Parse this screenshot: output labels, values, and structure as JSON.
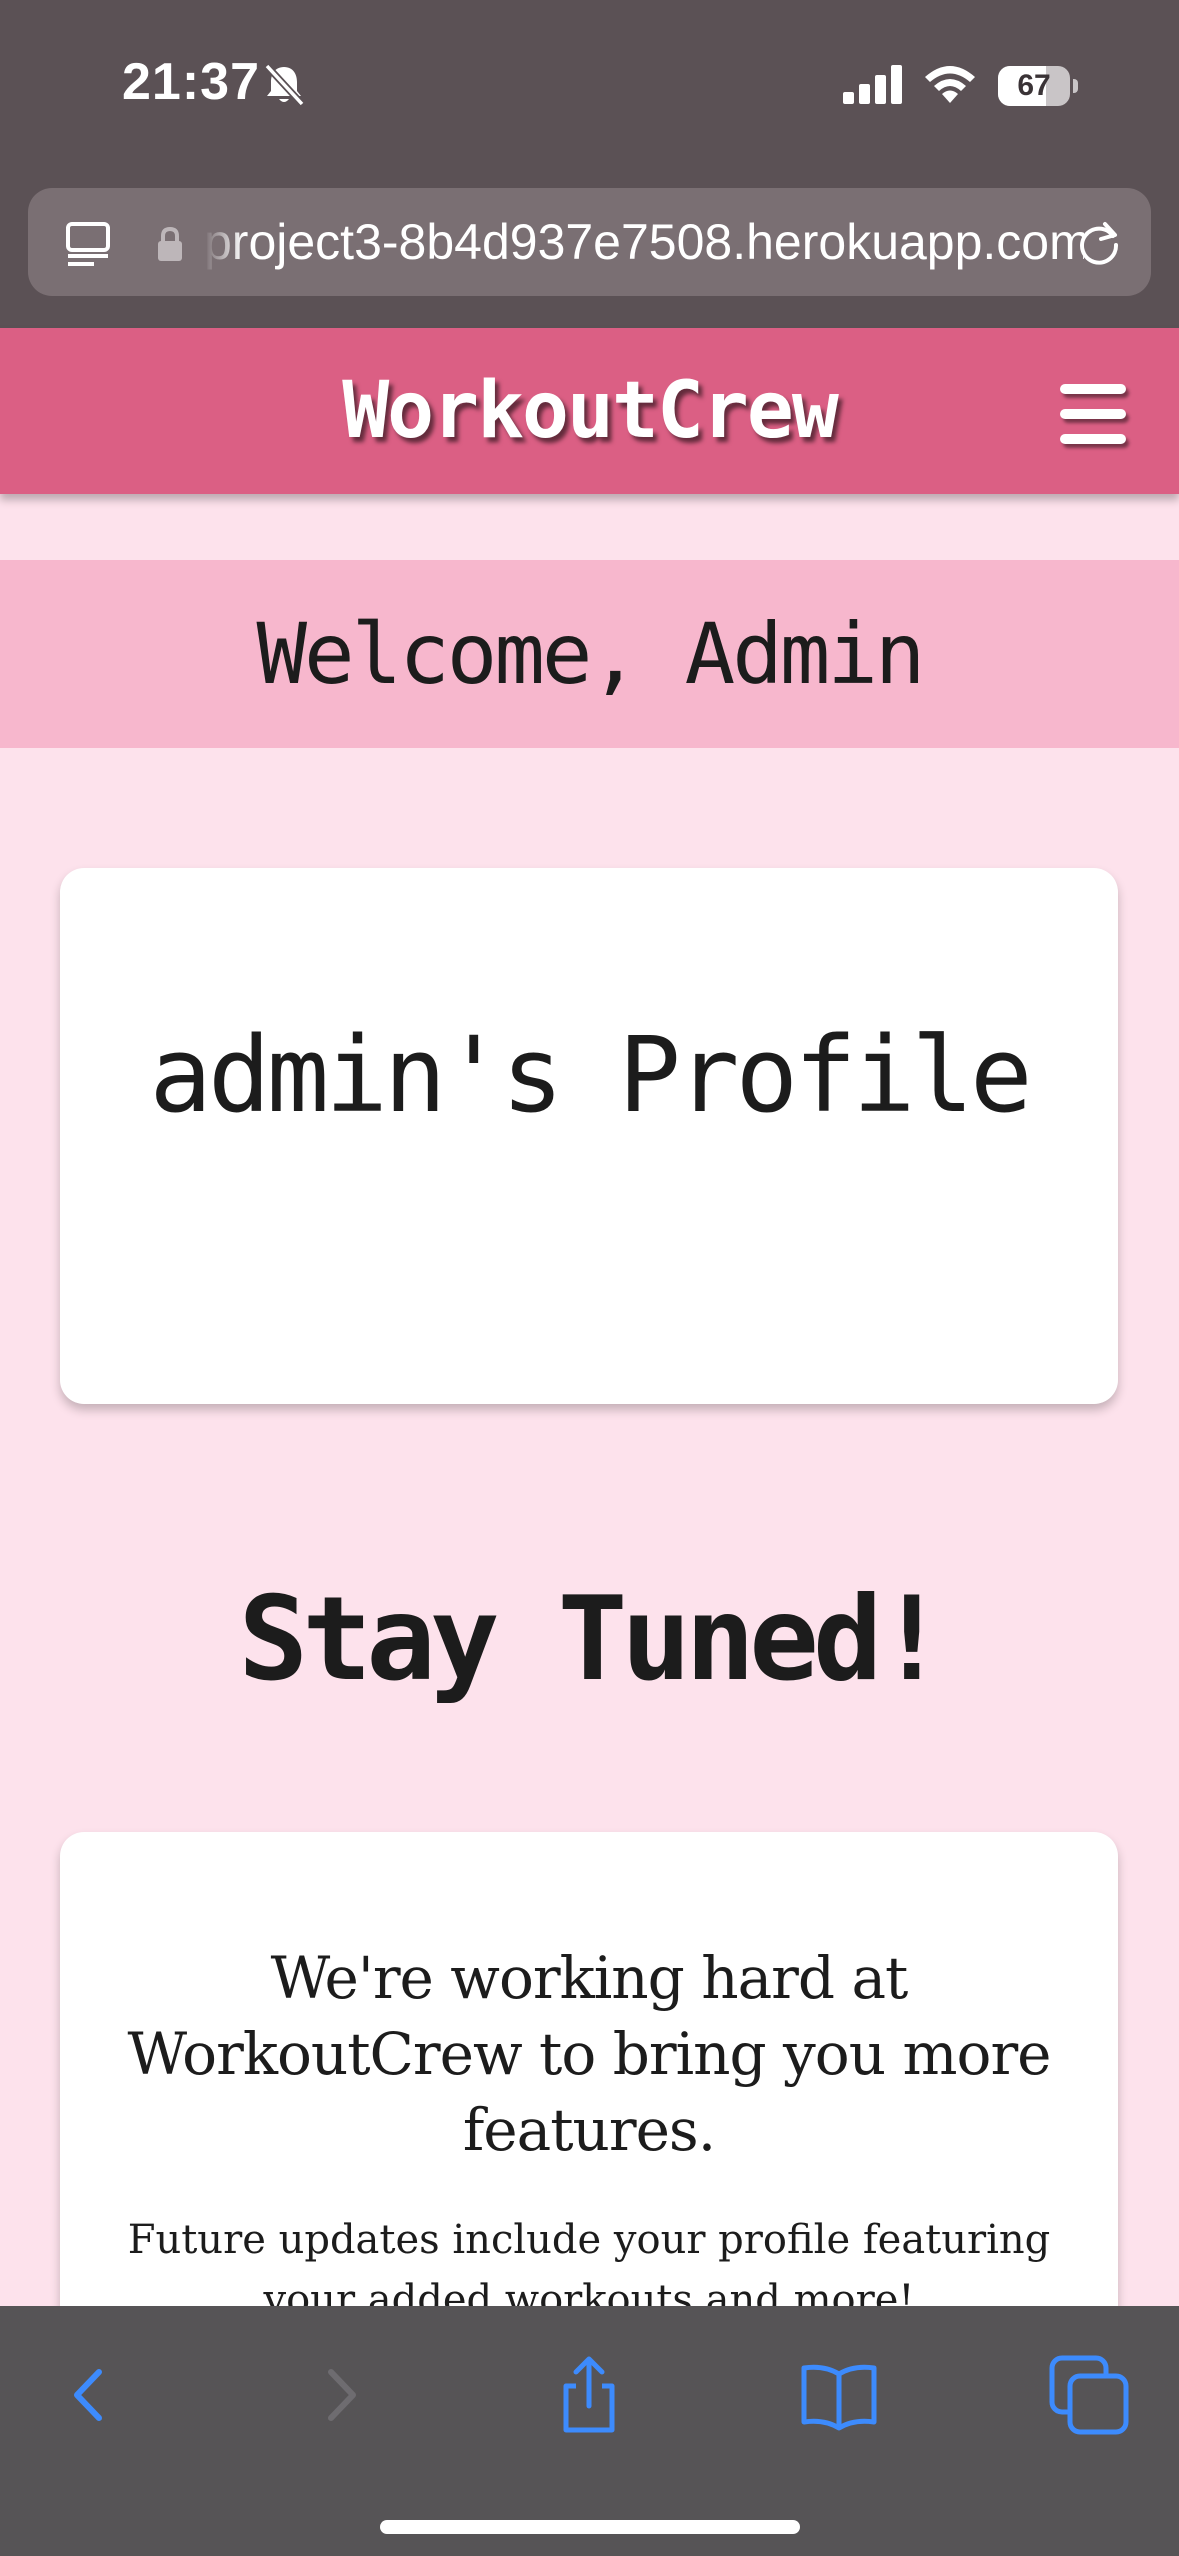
{
  "status_bar": {
    "time": "21:37",
    "battery_level": 67,
    "battery_label": "67",
    "icons": [
      "bell-slash-icon",
      "cellular-signal-icon",
      "wifi-icon",
      "battery-icon"
    ]
  },
  "browser": {
    "url": "project3-8b4d937e7508.herokuapp.com",
    "icons": [
      "tab-overview-icon",
      "lock-icon",
      "reload-icon"
    ]
  },
  "navbar": {
    "brand": "WorkoutCrew",
    "menu_icon": "hamburger-menu-icon"
  },
  "welcome": {
    "text": "Welcome, Admin"
  },
  "profile": {
    "title": "admin's Profile"
  },
  "stay_tuned": {
    "heading": "Stay Tuned!"
  },
  "info": {
    "heading": "We're working hard at WorkoutCrew to bring you more features.",
    "body": "Future updates include your profile featuring your added workouts and more!"
  },
  "toolbar": {
    "icons": [
      "back-icon",
      "forward-icon",
      "share-icon",
      "bookmarks-icon",
      "tabs-icon"
    ]
  },
  "colors": {
    "navbar": "#db5f84",
    "welcome_band": "#f7b7cd",
    "page_background": "#fde2ec",
    "browser_chrome": "#5b5155",
    "toolbar_accent": "#3d8bfd"
  }
}
